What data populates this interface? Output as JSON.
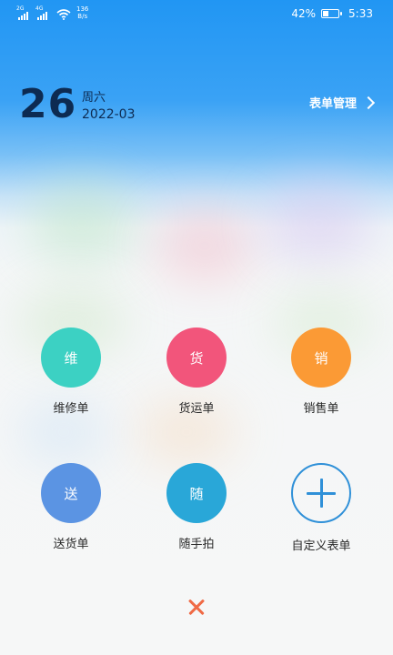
{
  "status_bar": {
    "network_label": "4G",
    "sim_tag_1": "2G",
    "sim_tag_2": "4G",
    "speed_value": "136",
    "speed_unit": "B/s",
    "battery_percent": "42%",
    "battery_level": 0.42,
    "time": "5:33"
  },
  "header": {
    "day": "26",
    "weekday": "周六",
    "year_month": "2022-03",
    "manage_label": "表单管理"
  },
  "grid": {
    "items": [
      {
        "glyph": "维",
        "label": "维修单",
        "color": "#3cd1c3",
        "icon": "repair-icon"
      },
      {
        "glyph": "货",
        "label": "货运单",
        "color": "#f2557b",
        "icon": "freight-icon"
      },
      {
        "glyph": "销",
        "label": "销售单",
        "color": "#fb9a35",
        "icon": "sales-icon"
      },
      {
        "glyph": "送",
        "label": "送货单",
        "color": "#5b94e3",
        "icon": "delivery-icon"
      },
      {
        "glyph": "随",
        "label": "随手拍",
        "color": "#29a7d8",
        "icon": "snapshot-icon"
      },
      {
        "glyph": "+",
        "label": "自定义表单",
        "color": "#2f90d8",
        "icon": "plus-icon"
      }
    ]
  },
  "footer": {
    "close_icon": "close-icon",
    "close_color": "#f06a45"
  }
}
